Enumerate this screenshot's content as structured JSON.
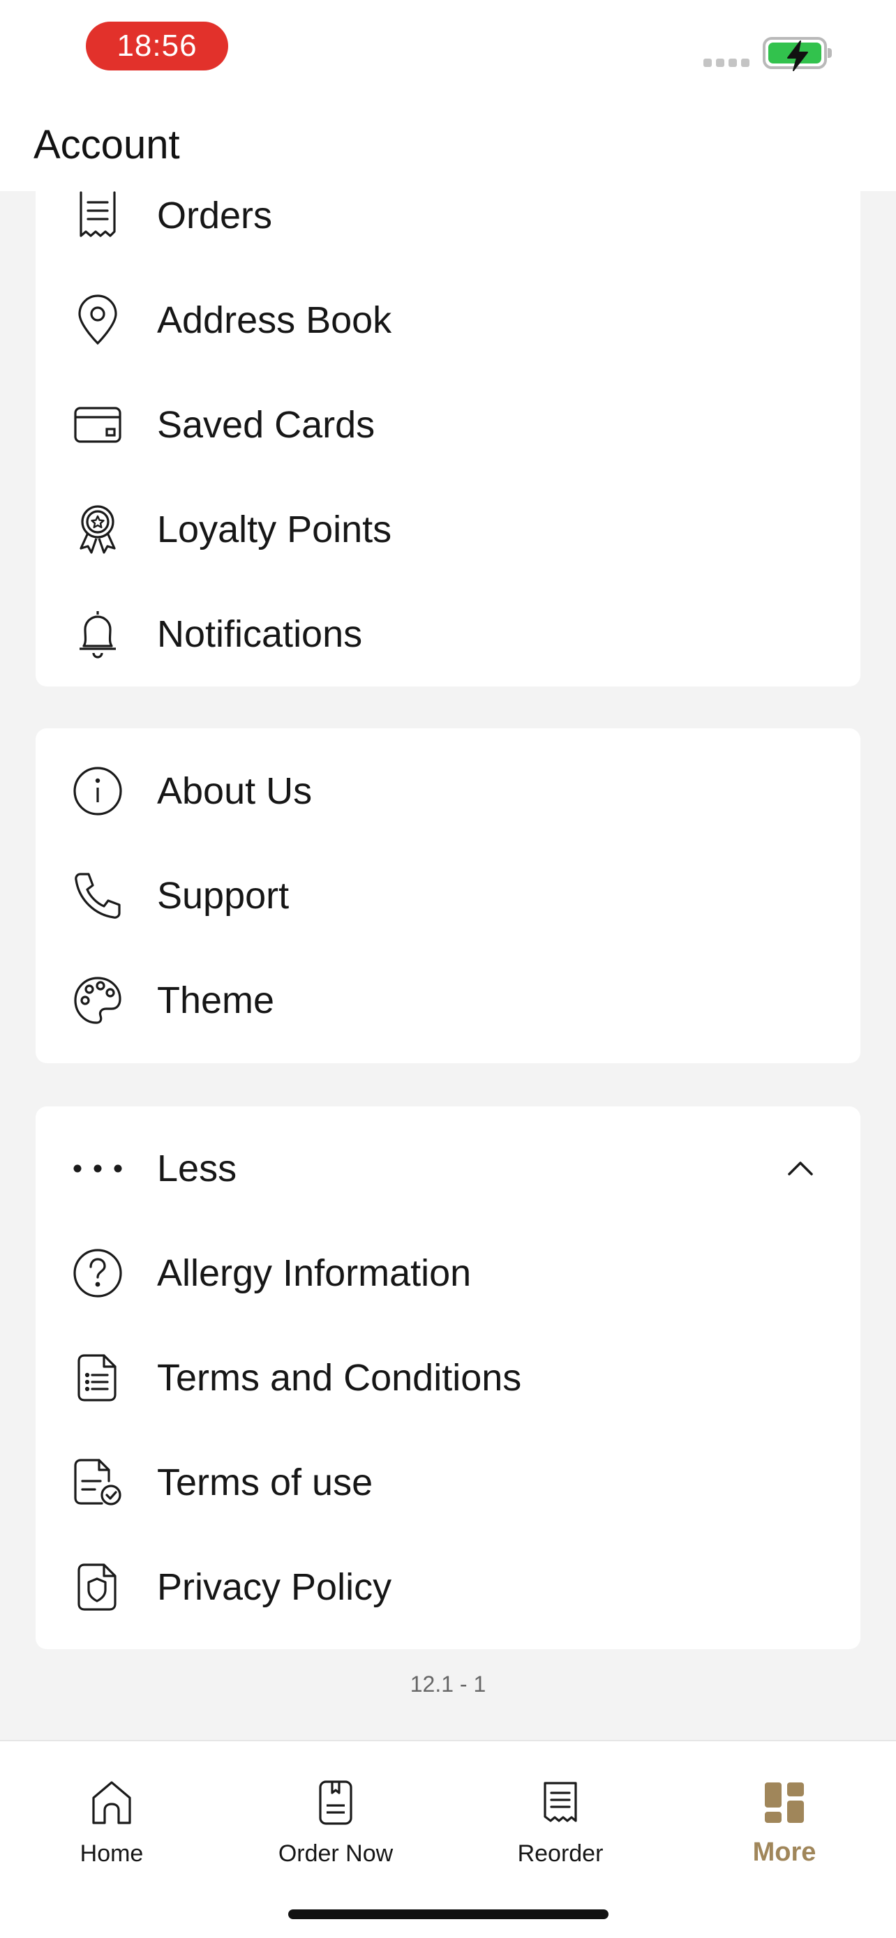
{
  "status_bar": {
    "time": "18:56",
    "battery_color": "#32c24d",
    "time_pill_color": "#e2312b"
  },
  "header": {
    "title": "Account"
  },
  "sections": [
    {
      "items": [
        {
          "label": "Orders",
          "icon": "receipt-icon"
        },
        {
          "label": "Address Book",
          "icon": "map-pin-icon"
        },
        {
          "label": "Saved Cards",
          "icon": "credit-card-icon"
        },
        {
          "label": "Loyalty Points",
          "icon": "award-ribbon-icon"
        },
        {
          "label": "Notifications",
          "icon": "bell-icon"
        }
      ]
    },
    {
      "items": [
        {
          "label": "About Us",
          "icon": "info-icon"
        },
        {
          "label": "Support",
          "icon": "phone-icon"
        },
        {
          "label": "Theme",
          "icon": "palette-icon"
        }
      ]
    },
    {
      "items": [
        {
          "label": "Less",
          "icon": "more-dots-icon",
          "expanded": true
        },
        {
          "label": "Allergy Information",
          "icon": "question-circle-icon"
        },
        {
          "label": "Terms and Conditions",
          "icon": "document-list-icon"
        },
        {
          "label": "Terms of use",
          "icon": "document-check-icon"
        },
        {
          "label": "Privacy Policy",
          "icon": "shield-document-icon"
        }
      ]
    }
  ],
  "version": "12.1 - 1",
  "tab_bar": {
    "active_color": "#a0865a",
    "tabs": [
      {
        "label": "Home",
        "icon": "home-icon"
      },
      {
        "label": "Order Now",
        "icon": "order-menu-icon"
      },
      {
        "label": "Reorder",
        "icon": "reorder-receipt-icon"
      },
      {
        "label": "More",
        "icon": "grid-icon",
        "active": true
      }
    ]
  }
}
